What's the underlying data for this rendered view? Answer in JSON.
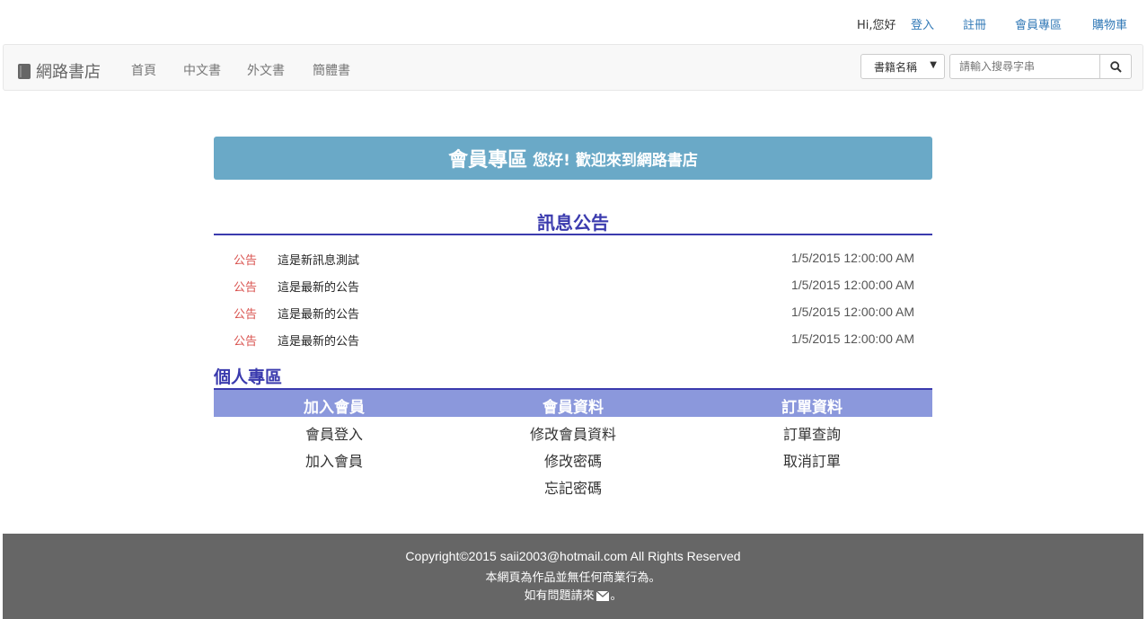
{
  "topbar": {
    "greeting": "Hi,您好",
    "links": [
      "登入",
      "註冊",
      "會員專區",
      "購物車"
    ]
  },
  "navbar": {
    "brand": "網路書店",
    "links": [
      "首頁",
      "中文書",
      "外文書",
      "簡體書"
    ],
    "search": {
      "category_selected": "書籍名稱",
      "placeholder": "請輸入搜尋字串"
    }
  },
  "banner": {
    "title": "會員專區",
    "subtitle": "您好! 歡迎來到網路書店"
  },
  "news": {
    "title": "訊息公告",
    "items": [
      {
        "tag": "公告",
        "text": "這是新訊息測試",
        "date": "1/5/2015 12:00:00 AM"
      },
      {
        "tag": "公告",
        "text": "這是最新的公告",
        "date": "1/5/2015 12:00:00 AM"
      },
      {
        "tag": "公告",
        "text": "這是最新的公告",
        "date": "1/5/2015 12:00:00 AM"
      },
      {
        "tag": "公告",
        "text": "這是最新的公告",
        "date": "1/5/2015 12:00:00 AM"
      }
    ]
  },
  "personal": {
    "title": "個人專區",
    "columns": [
      {
        "header": "加入會員",
        "items": [
          "會員登入",
          "加入會員"
        ]
      },
      {
        "header": "會員資料",
        "items": [
          "修改會員資料",
          "修改密碼",
          "忘記密碼"
        ]
      },
      {
        "header": "訂單資料",
        "items": [
          "訂單查詢",
          "取消訂單"
        ]
      }
    ]
  },
  "footer": {
    "copyright": "Copyright©2015 saii2003@hotmail.com All Rights Reserved",
    "notice": "本網頁為作品並無任何商業行為。",
    "contact_prefix": "如有問題請來",
    "contact_suffix": "。"
  },
  "colors": {
    "banner": "#6aa9c7",
    "accent": "#3b3bae",
    "grid_header": "#8b98dc",
    "news_tag": "#d9534f",
    "footer": "#666666"
  }
}
